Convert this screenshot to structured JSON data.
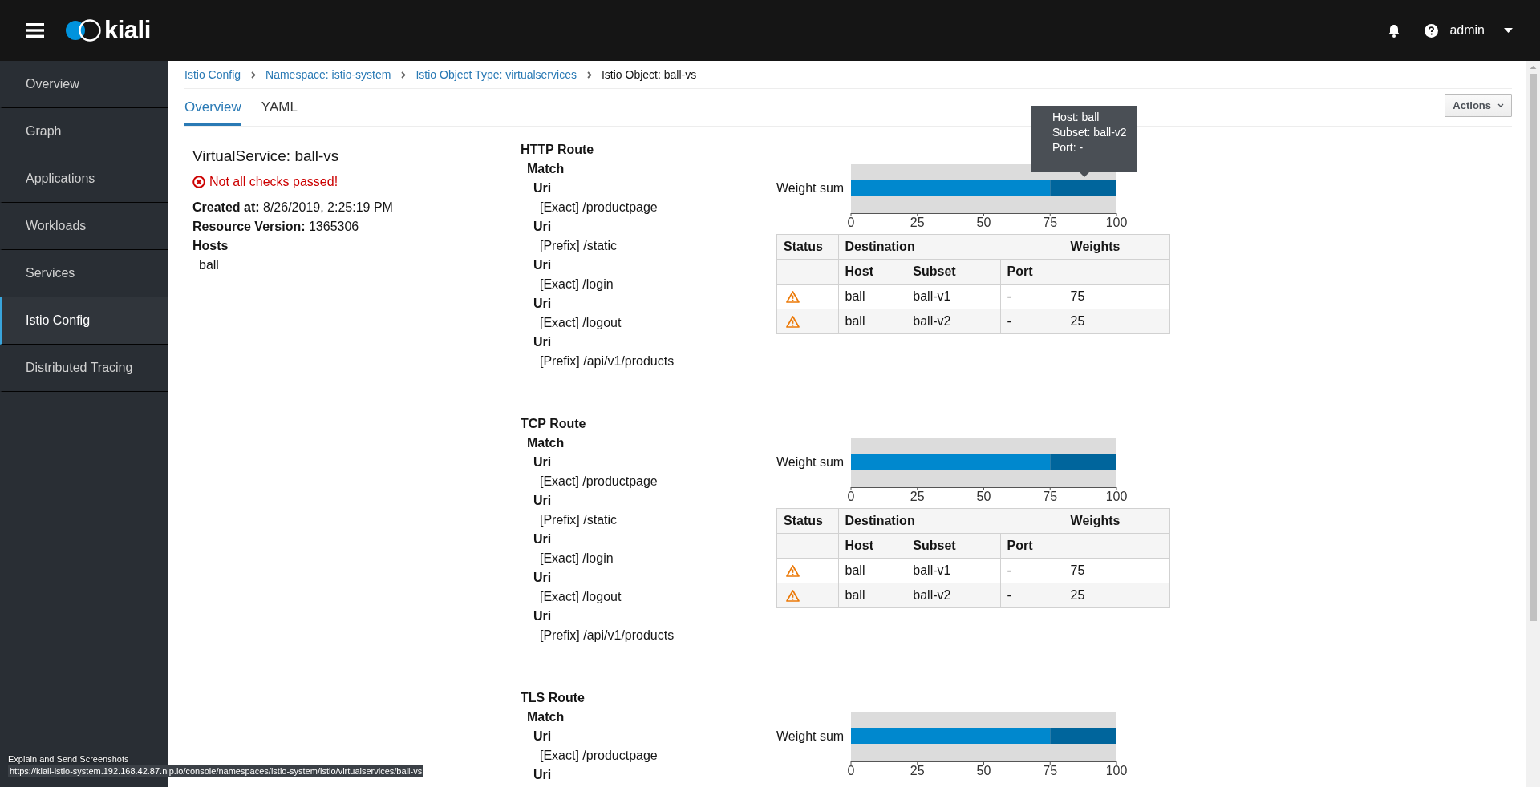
{
  "header": {
    "logo_text": "kiali",
    "user": "admin"
  },
  "sidebar": {
    "items": [
      {
        "label": "Overview",
        "selected": false
      },
      {
        "label": "Graph",
        "selected": false
      },
      {
        "label": "Applications",
        "selected": false
      },
      {
        "label": "Workloads",
        "selected": false
      },
      {
        "label": "Services",
        "selected": false
      },
      {
        "label": "Istio Config",
        "selected": true
      },
      {
        "label": "Distributed Tracing",
        "selected": false
      }
    ]
  },
  "breadcrumbs": [
    {
      "label": "Istio Config",
      "kind": "link"
    },
    {
      "label": "Namespace: istio-system",
      "kind": "link"
    },
    {
      "label": "Istio Object Type: virtualservices",
      "kind": "link"
    },
    {
      "label": "Istio Object: ball-vs",
      "kind": "current"
    }
  ],
  "tabs": [
    {
      "label": "Overview",
      "selected": true
    },
    {
      "label": "YAML",
      "selected": false
    }
  ],
  "actions_button": "Actions",
  "details": {
    "title": "VirtualService: ball-vs",
    "validation": {
      "kind": "error",
      "message": "Not all checks passed!"
    },
    "fields": [
      {
        "label": "Created at:",
        "value": "8/26/2019, 2:25:19 PM"
      },
      {
        "label": "Resource Version:",
        "value": "1365306"
      }
    ],
    "hosts_label": "Hosts",
    "hosts": [
      "ball"
    ]
  },
  "routes": [
    {
      "title": "HTTP Route",
      "match_label": "Match",
      "matches": [
        {
          "label": "Uri",
          "value": "[Exact] /productpage"
        },
        {
          "label": "Uri",
          "value": "[Prefix] /static"
        },
        {
          "label": "Uri",
          "value": "[Exact] /login"
        },
        {
          "label": "Uri",
          "value": "[Exact] /logout"
        },
        {
          "label": "Uri",
          "value": "[Prefix] /api/v1/products"
        }
      ],
      "chart_data": {
        "type": "bar",
        "orientation": "horizontal",
        "stacked": true,
        "categories": [
          "Weight sum"
        ],
        "xlim": [
          0,
          100
        ],
        "xticks": [
          0,
          25,
          50,
          75,
          100
        ],
        "series": [
          {
            "color": "#0088ce",
            "values": [
              75
            ]
          },
          {
            "color": "#00659c",
            "values": [
              25
            ]
          }
        ]
      },
      "tooltip": {
        "lines": [
          "Host: ball",
          "Subset: ball-v2",
          "Port: -"
        ]
      },
      "table": {
        "group_headers": [
          "Status",
          "Destination",
          "Weights"
        ],
        "columns": [
          "Host",
          "Subset",
          "Port"
        ],
        "rows": [
          {
            "kind": "warning",
            "host": "ball",
            "subset": "ball-v1",
            "port": "-",
            "weight": "75"
          },
          {
            "kind": "warning",
            "host": "ball",
            "subset": "ball-v2",
            "port": "-",
            "weight": "25"
          }
        ]
      }
    },
    {
      "title": "TCP Route",
      "match_label": "Match",
      "matches": [
        {
          "label": "Uri",
          "value": "[Exact] /productpage"
        },
        {
          "label": "Uri",
          "value": "[Prefix] /static"
        },
        {
          "label": "Uri",
          "value": "[Exact] /login"
        },
        {
          "label": "Uri",
          "value": "[Exact] /logout"
        },
        {
          "label": "Uri",
          "value": "[Prefix] /api/v1/products"
        }
      ],
      "chart_data": {
        "type": "bar",
        "orientation": "horizontal",
        "stacked": true,
        "categories": [
          "Weight sum"
        ],
        "xlim": [
          0,
          100
        ],
        "xticks": [
          0,
          25,
          50,
          75,
          100
        ],
        "series": [
          {
            "color": "#0088ce",
            "values": [
              75
            ]
          },
          {
            "color": "#00659c",
            "values": [
              25
            ]
          }
        ]
      },
      "table": {
        "group_headers": [
          "Status",
          "Destination",
          "Weights"
        ],
        "columns": [
          "Host",
          "Subset",
          "Port"
        ],
        "rows": [
          {
            "kind": "warning",
            "host": "ball",
            "subset": "ball-v1",
            "port": "-",
            "weight": "75"
          },
          {
            "kind": "warning",
            "host": "ball",
            "subset": "ball-v2",
            "port": "-",
            "weight": "25"
          }
        ]
      }
    },
    {
      "title": "TLS Route",
      "match_label": "Match",
      "matches": [
        {
          "label": "Uri",
          "value": "[Exact] /productpage"
        },
        {
          "label": "Uri"
        }
      ],
      "chart_data": {
        "type": "bar",
        "orientation": "horizontal",
        "stacked": true,
        "categories": [
          "Weight sum"
        ],
        "xlim": [
          0,
          100
        ],
        "xticks": [
          0,
          25,
          50,
          75,
          100
        ],
        "series": [
          {
            "color": "#0088ce",
            "values": [
              75
            ]
          },
          {
            "color": "#00659c",
            "values": [
              25
            ]
          }
        ]
      }
    }
  ],
  "status_overlay": {
    "title": "Explain and Send Screenshots",
    "url": "https://kiali-istio-system.192.168.42.87.nip.io/console/namespaces/istio-system/istio/virtualservices/ball-vs"
  }
}
